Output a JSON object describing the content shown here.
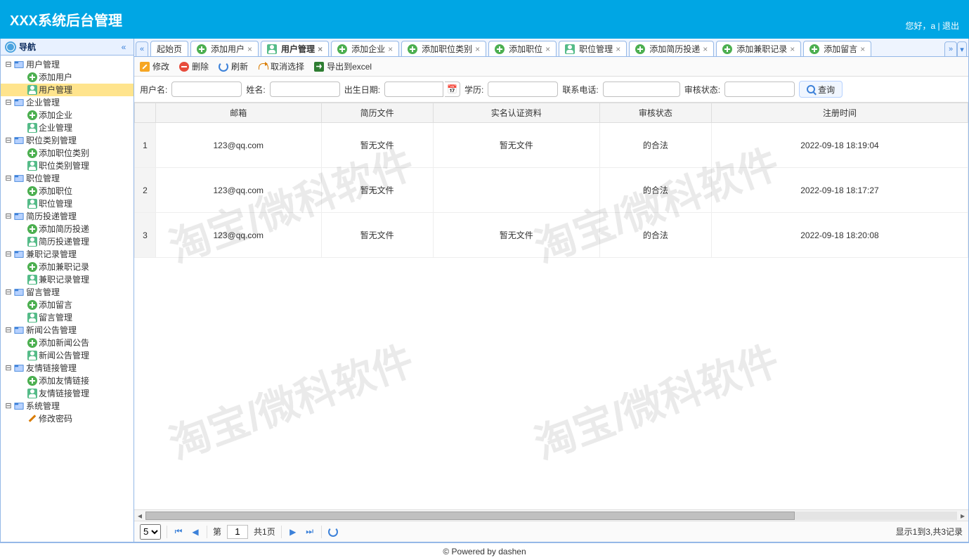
{
  "header": {
    "title": "XXX系统后台管理",
    "greeting": "您好，a",
    "sep": " | ",
    "logout": "退出"
  },
  "sidebar": {
    "title": "导航",
    "groups": [
      {
        "label": "用户管理",
        "children": [
          {
            "label": "添加用户",
            "icon": "add"
          },
          {
            "label": "用户管理",
            "icon": "person",
            "selected": true
          }
        ]
      },
      {
        "label": "企业管理",
        "children": [
          {
            "label": "添加企业",
            "icon": "add"
          },
          {
            "label": "企业管理",
            "icon": "person"
          }
        ]
      },
      {
        "label": "职位类别管理",
        "children": [
          {
            "label": "添加职位类别",
            "icon": "add"
          },
          {
            "label": "职位类别管理",
            "icon": "person"
          }
        ]
      },
      {
        "label": "职位管理",
        "children": [
          {
            "label": "添加职位",
            "icon": "add"
          },
          {
            "label": "职位管理",
            "icon": "person"
          }
        ]
      },
      {
        "label": "简历投递管理",
        "children": [
          {
            "label": "添加简历投递",
            "icon": "add"
          },
          {
            "label": "简历投递管理",
            "icon": "person"
          }
        ]
      },
      {
        "label": "兼职记录管理",
        "children": [
          {
            "label": "添加兼职记录",
            "icon": "add"
          },
          {
            "label": "兼职记录管理",
            "icon": "person"
          }
        ]
      },
      {
        "label": "留言管理",
        "children": [
          {
            "label": "添加留言",
            "icon": "add"
          },
          {
            "label": "留言管理",
            "icon": "person"
          }
        ]
      },
      {
        "label": "新闻公告管理",
        "children": [
          {
            "label": "添加新闻公告",
            "icon": "add"
          },
          {
            "label": "新闻公告管理",
            "icon": "person"
          }
        ]
      },
      {
        "label": "友情链接管理",
        "children": [
          {
            "label": "添加友情链接",
            "icon": "add"
          },
          {
            "label": "友情链接管理",
            "icon": "person"
          }
        ]
      },
      {
        "label": "系统管理",
        "children": [
          {
            "label": "修改密码",
            "icon": "pencil"
          }
        ]
      }
    ]
  },
  "tabs": {
    "items": [
      {
        "label": "起始页",
        "closable": false
      },
      {
        "label": "添加用户",
        "closable": true,
        "icon": "add"
      },
      {
        "label": "用户管理",
        "closable": true,
        "icon": "person",
        "active": true
      },
      {
        "label": "添加企业",
        "closable": true,
        "icon": "add"
      },
      {
        "label": "添加职位类别",
        "closable": true,
        "icon": "add"
      },
      {
        "label": "添加职位",
        "closable": true,
        "icon": "add"
      },
      {
        "label": "职位管理",
        "closable": true,
        "icon": "person"
      },
      {
        "label": "添加简历投递",
        "closable": true,
        "icon": "add"
      },
      {
        "label": "添加兼职记录",
        "closable": true,
        "icon": "add"
      },
      {
        "label": "添加留言",
        "closable": true,
        "icon": "add"
      }
    ]
  },
  "toolbar": {
    "edit": "修改",
    "delete": "删除",
    "refresh": "刷新",
    "cancel": "取消选择",
    "export": "导出到excel"
  },
  "filters": {
    "username": "用户名:",
    "realname": "姓名:",
    "birth": "出生日期:",
    "edu": "学历:",
    "phone": "联系电话:",
    "audit": "审核状态:",
    "search": "查询"
  },
  "grid": {
    "columns": [
      "邮箱",
      "简历文件",
      "实名认证资料",
      "审核状态",
      "注册时间"
    ],
    "rows": [
      {
        "n": "1",
        "email": "123@qq.com",
        "resume": "暂无文件",
        "auth": "暂无文件",
        "status": "的合法",
        "time": "2022-09-18 18:19:04"
      },
      {
        "n": "2",
        "email": "123@qq.com",
        "resume": "暂无文件",
        "auth": "",
        "status": "的合法",
        "time": "2022-09-18 18:17:27"
      },
      {
        "n": "3",
        "email": "123@qq.com",
        "resume": "暂无文件",
        "auth": "暂无文件",
        "status": "的合法",
        "time": "2022-09-18 18:20:08"
      }
    ]
  },
  "pager": {
    "pageSizeOptions": [
      "5"
    ],
    "pageSize": "5",
    "pageLabelPre": "第",
    "pageNum": "1",
    "pageLabelPost": "共1页",
    "info": "显示1到3,共3记录"
  },
  "footer": "© Powered by dashen",
  "watermark": "淘宝/微科软件"
}
